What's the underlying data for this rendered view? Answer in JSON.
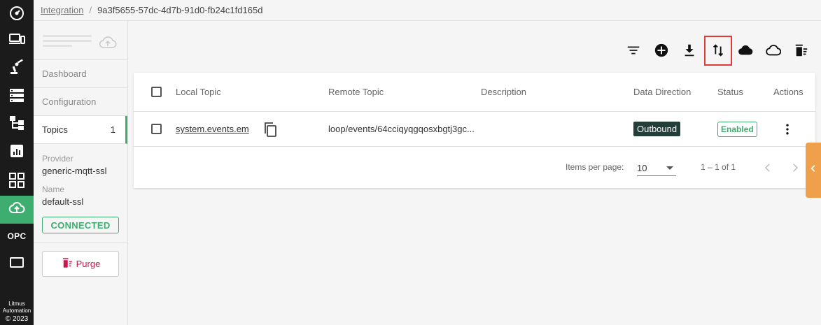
{
  "rail": {
    "items": [
      {
        "icon": "dashboard-gauge-icon"
      },
      {
        "icon": "devices-icon"
      },
      {
        "icon": "robot-arm-icon"
      },
      {
        "icon": "server-list-icon"
      },
      {
        "icon": "hierarchy-tree-icon"
      },
      {
        "icon": "analytics-chart-icon"
      },
      {
        "icon": "apps-grid-icon"
      },
      {
        "icon": "cloud-upload-icon",
        "active": true
      },
      {
        "label": "OPC"
      },
      {
        "icon": "screen-icon"
      }
    ],
    "footer": {
      "line1": "Litmus",
      "line2": "Automation",
      "copyright": "© 2023"
    }
  },
  "breadcrumb": {
    "parent": "Integration",
    "current": "9a3f5655-57dc-4d7b-91d0-fb24c1fd165d"
  },
  "sidebar": {
    "nav": [
      {
        "label": "Dashboard"
      },
      {
        "label": "Configuration"
      },
      {
        "label": "Topics",
        "count": "1",
        "active": true
      }
    ],
    "provider_label": "Provider",
    "provider_value": "generic-mqtt-ssl",
    "name_label": "Name",
    "name_value": "default-ssl",
    "status": "CONNECTED",
    "purge_label": "Purge"
  },
  "toolbar": {
    "icons": [
      "filter-icon",
      "add-circle-icon",
      "download-icon",
      "swap-vertical-icon",
      "cloud-filled-icon",
      "cloud-outline-icon",
      "delete-all-icon"
    ],
    "highlighted": "swap-vertical-icon"
  },
  "table": {
    "columns": [
      "Local Topic",
      "Remote Topic",
      "Description",
      "Data Direction",
      "Status",
      "Actions"
    ],
    "rows": [
      {
        "local_topic": "system.events.em",
        "remote_topic": "loop/events/64cciqyqgqosxbgtj3gc...",
        "description": "",
        "direction": "Outbound",
        "status": "Enabled"
      }
    ]
  },
  "pagination": {
    "items_per_page_label": "Items per page:",
    "items_per_page_value": "10",
    "range": "1 – 1 of 1"
  },
  "colors": {
    "accent_green": "#3dae6f",
    "rail_bg": "#1b1b1b",
    "outbound_bg": "#233d38",
    "purge_red": "#c8174d",
    "highlight_red": "#e03a3a",
    "right_tab_orange": "#f0a04b"
  }
}
